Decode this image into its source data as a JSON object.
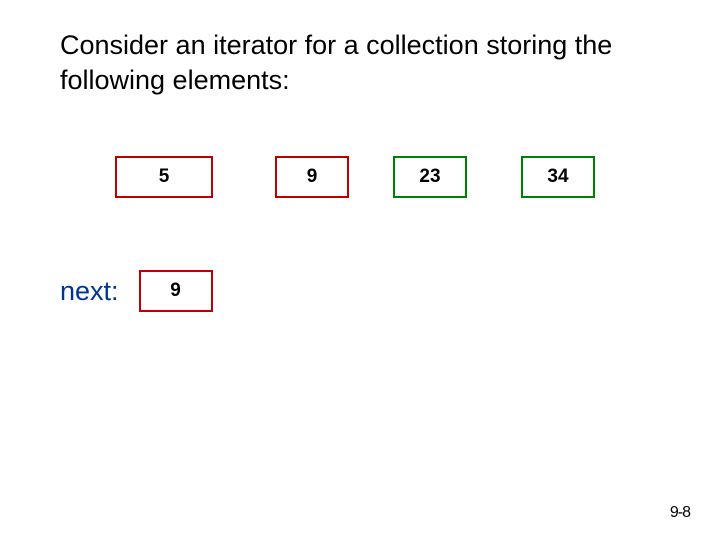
{
  "heading": "Consider an iterator for a collection storing the following elements:",
  "elements": [
    "5",
    "9",
    "23",
    "34"
  ],
  "next_label": "next:",
  "next_value": "9",
  "page_number": "9-8"
}
